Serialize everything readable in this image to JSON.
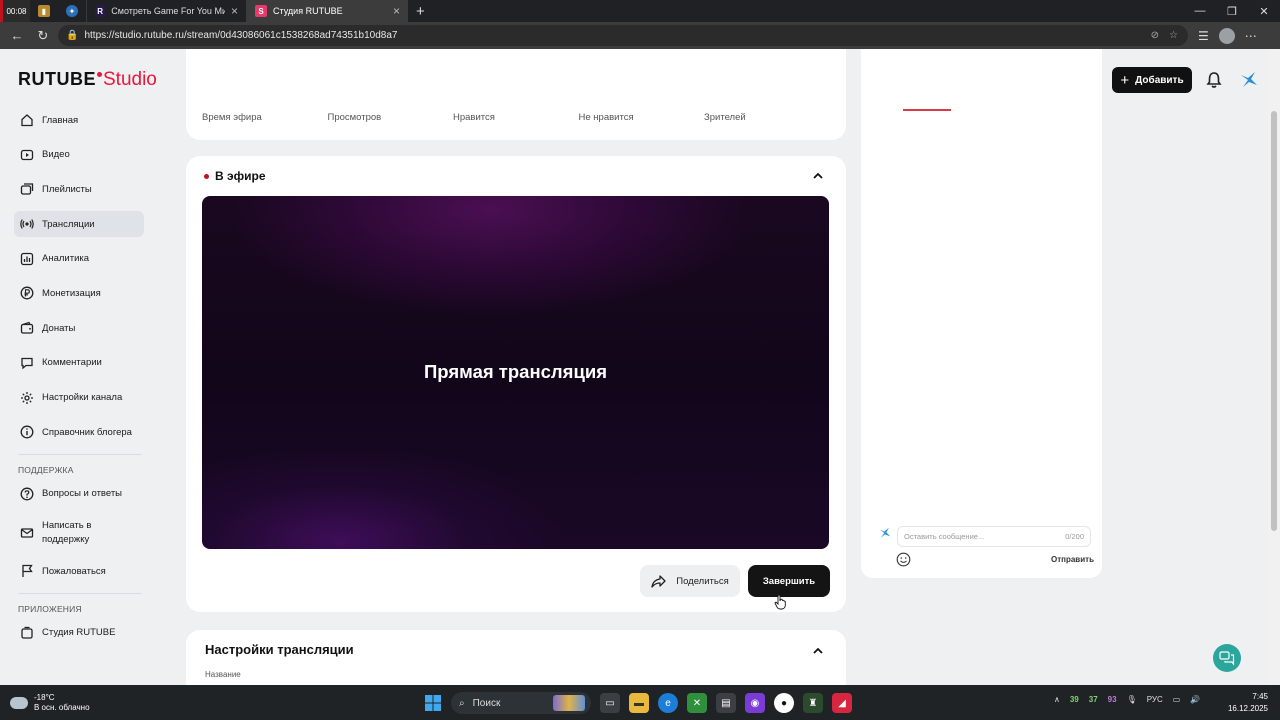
{
  "browser": {
    "tab_time": "00:08",
    "tabs": [
      {
        "label": "Смотреть Game For You Мишан",
        "active": false
      },
      {
        "label": "Студия RUTUBE",
        "active": true
      }
    ],
    "url": "https://studio.rutube.ru/stream/0d43086061c1538268ad74351b10d8a7"
  },
  "header": {
    "logo_main": "RUTUBE",
    "logo_studio": "Studio",
    "add_label": "Добавить"
  },
  "sidebar": {
    "items": [
      {
        "label": "Главная",
        "icon": "home-icon"
      },
      {
        "label": "Видео",
        "icon": "video-icon"
      },
      {
        "label": "Плейлисты",
        "icon": "playlist-icon"
      },
      {
        "label": "Трансляции",
        "icon": "broadcast-icon",
        "active": true
      },
      {
        "label": "Аналитика",
        "icon": "analytics-icon"
      },
      {
        "label": "Монетизация",
        "icon": "ruble-icon"
      },
      {
        "label": "Донаты",
        "icon": "wallet-icon"
      },
      {
        "label": "Комментарии",
        "icon": "comment-icon"
      },
      {
        "label": "Настройки канала",
        "icon": "gear-icon"
      },
      {
        "label": "Справочник блогера",
        "icon": "info-icon"
      }
    ],
    "support_heading": "ПОДДЕРЖКА",
    "support_items": [
      {
        "label": "Вопросы и ответы",
        "icon": "question-icon"
      },
      {
        "label": "Написать в поддержку",
        "icon": "mail-icon"
      },
      {
        "label": "Пожаловаться",
        "icon": "flag-icon"
      }
    ],
    "apps_heading": "ПРИЛОЖЕНИЯ",
    "apps_items": [
      {
        "label": "Студия RUTUBE",
        "icon": "studio-app-icon"
      }
    ]
  },
  "stats": {
    "labels": [
      "Время эфира",
      "Просмотров",
      "Нравится",
      "Не нравится",
      "Зрителей"
    ]
  },
  "live": {
    "status": "В эфире",
    "video_title": "Прямая трансляция",
    "share_label": "Поделиться",
    "finish_label": "Завершить"
  },
  "settings": {
    "title": "Настройки трансляции",
    "name_label": "Название"
  },
  "chat": {
    "placeholder": "Оставить сообщение...",
    "counter": "0/200",
    "send_label": "Отправить"
  },
  "taskbar": {
    "temperature": "-18°C",
    "weather": "В осн. облачно",
    "search_placeholder": "Поиск",
    "tray_nums": [
      "39",
      "37",
      "93"
    ],
    "language": "РУС",
    "time": "7:45",
    "date": "16.12.2025"
  },
  "colors": {
    "brand_red": "#ed143d",
    "live_dot": "#c1121f",
    "help_fab": "#2aa69d"
  }
}
